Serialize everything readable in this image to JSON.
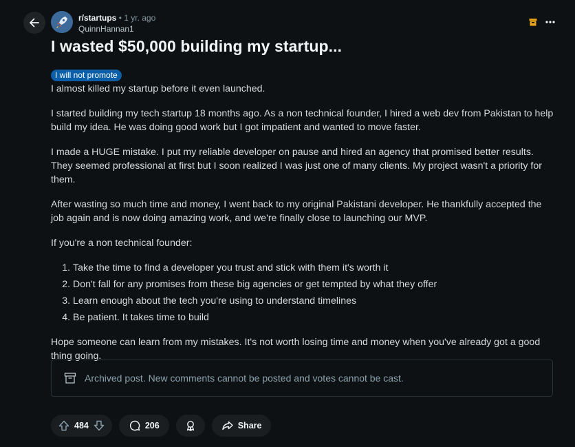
{
  "post": {
    "subreddit": "r/startups",
    "separator": "•",
    "age": "1 yr. ago",
    "author": "QuinnHannan1",
    "title": "I wasted $50,000 building my startup...",
    "flair": "I will not promote",
    "paragraphs_top": [
      "I almost killed my startup before it even launched.",
      "I started building my tech startup 18 months ago. As a non technical founder, I hired a web dev from Pakistan to help build my idea. He was doing good work but I got impatient and wanted to move faster.",
      "I made a HUGE mistake. I put my reliable developer on pause and hired an agency that promised better results. They seemed professional at first but I soon realized I was just one of many clients. My project wasn't a priority for them.",
      "After wasting so much time and money, I went back to my original Pakistani developer. He thankfully accepted the job again and is now doing amazing work, and we're finally close to launching our MVP.",
      "If you're a non technical founder:"
    ],
    "list_items": [
      "Take the time to find a developer you trust and stick with them it's worth it",
      "Don't fall for any promises from these big agencies or get tempted by what they offer",
      "Learn enough about the tech you're using to understand timelines",
      "Be patient. It takes time to build"
    ],
    "paragraph_bottom": "Hope someone can learn from my mistakes. It's not worth losing time and money when you've already got a good thing going."
  },
  "archived": {
    "message": "Archived post. New comments cannot be posted and votes cannot be cast.",
    "icon": "archive-icon"
  },
  "actions": {
    "score": "484",
    "comments": "206",
    "share_label": "Share"
  },
  "colors": {
    "background": "#0e1113",
    "flair": "#0a5fa8",
    "archive_icon": "#e8a317"
  }
}
